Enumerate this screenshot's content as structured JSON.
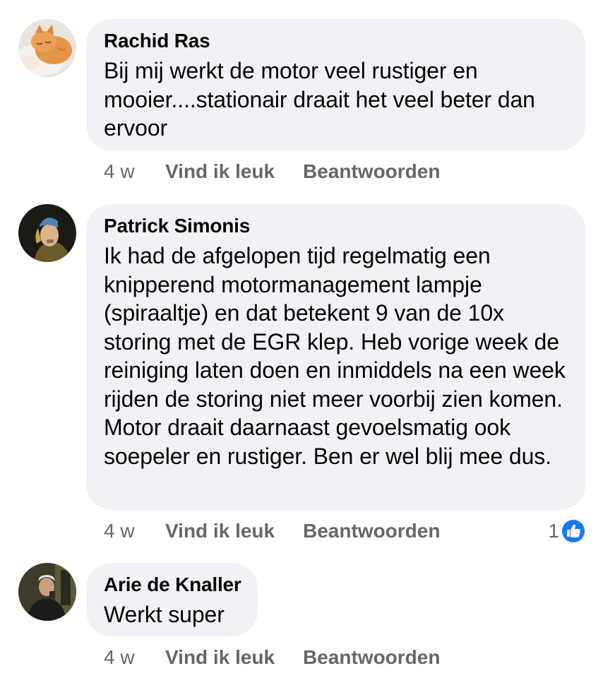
{
  "comments": [
    {
      "author": "Rachid Ras",
      "avatar_icon": "cat-photo-avatar",
      "text": "Bij mij werkt de motor veel rustiger en mooier....stationair draait het veel beter dan ervoor",
      "time": "4 w",
      "like_label": "Vind ik leuk",
      "reply_label": "Beantwoorden"
    },
    {
      "author": "Patrick Simonis",
      "avatar_icon": "painting-portrait-avatar",
      "text": "Ik had de afgelopen tijd regelmatig een knipperend motormanagement lampje (spiraaltje) en dat betekent 9 van de 10x storing met de EGR klep. Heb vorige week de reiniging laten doen en inmiddels na een week rijden de storing niet meer voorbij zien komen. Motor draait daarnaast gevoelsmatig ook soepeler en rustiger. Ben er wel blij mee dus.",
      "time": "4 w",
      "like_label": "Vind ik leuk",
      "reply_label": "Beantwoorden",
      "reaction_count": "1",
      "reaction_icon": "thumbs-up-icon",
      "reaction_color": "#1877f2"
    },
    {
      "author": "Arie de Knaller",
      "avatar_icon": "person-photo-avatar",
      "text": "Werkt super",
      "time": "4 w",
      "like_label": "Vind ik leuk",
      "reply_label": "Beantwoorden"
    }
  ]
}
